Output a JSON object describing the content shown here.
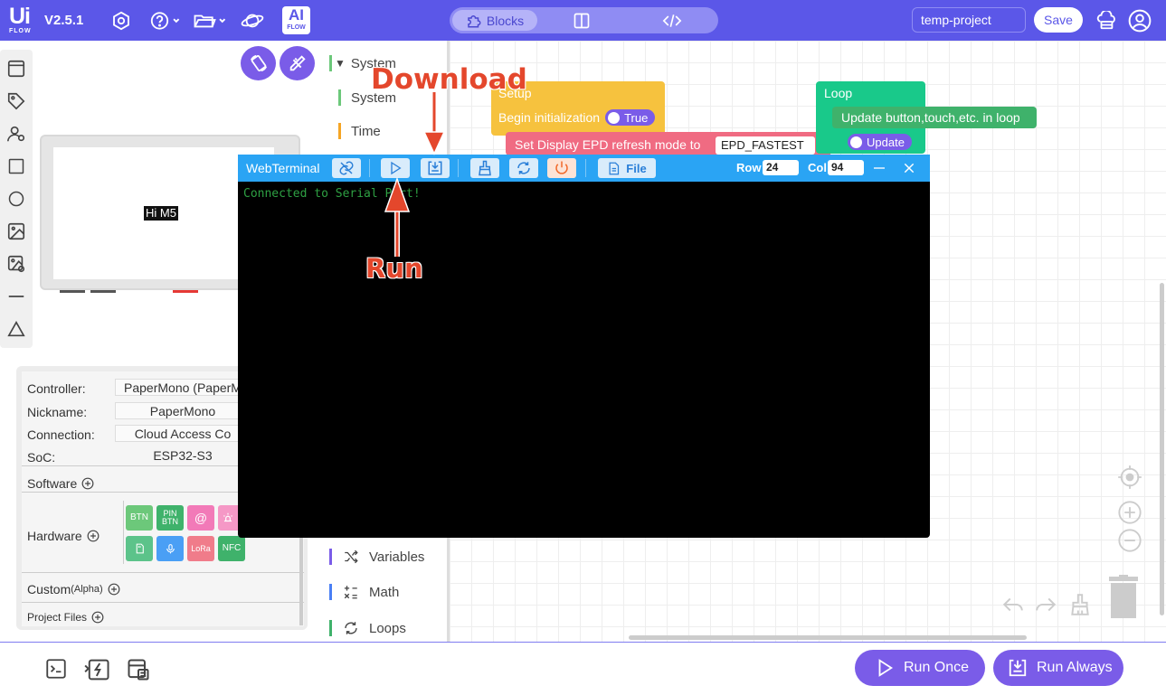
{
  "topbar": {
    "logo_text": "Ui",
    "logo_sub": "FLOW",
    "version": "V2.5.1",
    "ai_badge_top": "AI",
    "ai_badge_bottom": "FLOW",
    "tabs": [
      {
        "label": "Blocks"
      }
    ],
    "project_name": "temp-project",
    "save_label": "Save",
    "accent_color": "#5b57e8"
  },
  "device": {
    "screen_text": "Hi M5"
  },
  "info": {
    "controller_label": "Controller:",
    "controller_value": "PaperMono (PaperM",
    "nickname_label": "Nickname:",
    "nickname_value": "PaperMono",
    "connection_label": "Connection:",
    "connection_value": "Cloud Access Co",
    "soc_label": "SoC:",
    "soc_value": "ESP32-S3",
    "software_label": "Software",
    "hardware_label": "Hardware",
    "custom_label": "Custom",
    "custom_suffix": "(Alpha)",
    "project_files_label": "Project Files",
    "hardware_items": [
      {
        "label": "BTN",
        "color": "#6cc87a"
      },
      {
        "label": "PIN BTN",
        "color": "#3fb26b"
      },
      {
        "label": "@",
        "color": "#f27ab8"
      },
      {
        "label": "",
        "color": "#f598c6"
      },
      {
        "label": "",
        "color": "#5cc38a"
      },
      {
        "label": "",
        "color": "#4a9ff5"
      },
      {
        "label": "LoRa",
        "color": "#f07c8a"
      },
      {
        "label": "NFC",
        "color": "#3fb26b"
      }
    ]
  },
  "categories": {
    "top": [
      {
        "label": "System",
        "color": "#6cc87a",
        "expanded": true
      },
      {
        "label": "System",
        "color": "#6cc87a"
      },
      {
        "label": "Time",
        "color": "#f5a524"
      }
    ],
    "bottom": [
      {
        "label": "Variables",
        "color": "#7a5ce8"
      },
      {
        "label": "Math",
        "color": "#4a7ff5"
      },
      {
        "label": "Loops",
        "color": "#3fb26b"
      }
    ]
  },
  "blocks": {
    "setup_title": "Setup",
    "begin_init": "Begin initialization",
    "begin_init_value": "True",
    "epd_label": "Set Display EPD refresh mode to",
    "epd_value": "EPD_FASTEST",
    "loop_title": "Loop",
    "update_label": "Update button,touch,etc. in loop",
    "update_value": "Update"
  },
  "terminal": {
    "title": "WebTerminal",
    "file_label": "File",
    "row_label": "Row",
    "row_value": "24",
    "col_label": "Col",
    "col_value": "94",
    "output": "Connected to Serial Port!",
    "bar_color": "#2aa4f4"
  },
  "annotations": {
    "download": "Download",
    "run": "Run",
    "color": "#e4472c"
  },
  "bottombar": {
    "run_once": "Run Once",
    "run_always": "Run Always"
  }
}
